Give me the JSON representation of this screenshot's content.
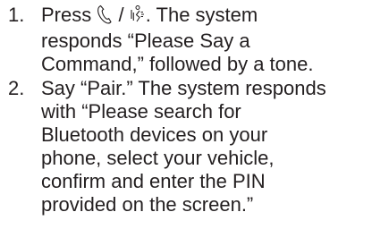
{
  "steps": [
    {
      "number": "1.",
      "lines": [
        {
          "before_icons": "Press ",
          "icon_separator": " / ",
          "after_icons": ". The system"
        },
        {
          "text": "responds “Please Say a"
        },
        {
          "text": "Command,” followed by a tone."
        }
      ],
      "icons": [
        "phone-handset-icon",
        "voice-command-icon"
      ]
    },
    {
      "number": "2.",
      "lines": [
        {
          "text": "Say “Pair.” The system responds"
        },
        {
          "text": "with “Please search for"
        },
        {
          "text": "Bluetooth devices on your"
        },
        {
          "text": "phone, select your vehicle,"
        },
        {
          "text": "confirm and enter the PIN"
        },
        {
          "text": "provided on the screen.”"
        }
      ]
    }
  ]
}
